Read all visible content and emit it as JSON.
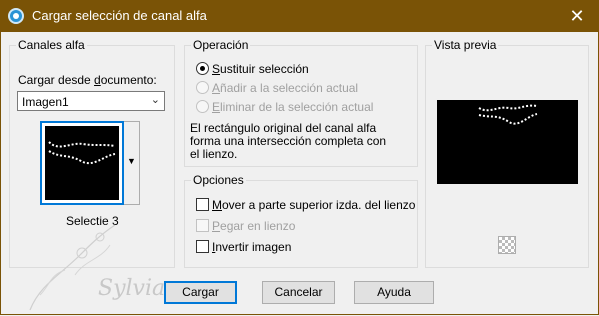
{
  "window": {
    "title": "Cargar selección de canal alfa",
    "close_glyph": "✕",
    "icon": "app-icon",
    "title_bar_color": "#7a5306"
  },
  "alpha_channels": {
    "group_label": "Canales alfa",
    "load_label_prefix": "Cargar desde ",
    "load_label_accel": "d",
    "load_label_suffix": "ocumento:",
    "document_value": "Imagen1",
    "selection_name": "Selectie 3"
  },
  "operation": {
    "group_label": "Operación",
    "options": [
      {
        "accel": "S",
        "rest": "ustituir selección",
        "checked": true,
        "enabled": true
      },
      {
        "accel": "A",
        "rest": "ñadir a la selección actual",
        "checked": false,
        "enabled": false
      },
      {
        "accel": "E",
        "rest": "liminar de la selección actual",
        "checked": false,
        "enabled": false
      }
    ],
    "description_lines": [
      "El rectángulo original del canal alfa",
      "forma una intersección completa con",
      "el lienzo."
    ]
  },
  "options": {
    "group_label": "Opciones",
    "items": [
      {
        "accel": "M",
        "rest": "over a parte superior izda. del lienzo",
        "checked": false,
        "enabled": true
      },
      {
        "accel": "P",
        "rest": "egar en lienzo",
        "checked": false,
        "enabled": false
      },
      {
        "accel": "I",
        "rest": "nvertir imagen",
        "checked": false,
        "enabled": true
      }
    ]
  },
  "preview": {
    "group_label": "Vista previa",
    "toggle_icon": "checkerboard-icon"
  },
  "buttons": {
    "load": "Cargar",
    "cancel": "Cancelar",
    "help": "Ayuda"
  },
  "watermark_text": "Sylviane",
  "colors": {
    "accent": "#0078d7",
    "group_border": "#dcdcdc",
    "disabled": "#a0a0a0"
  }
}
